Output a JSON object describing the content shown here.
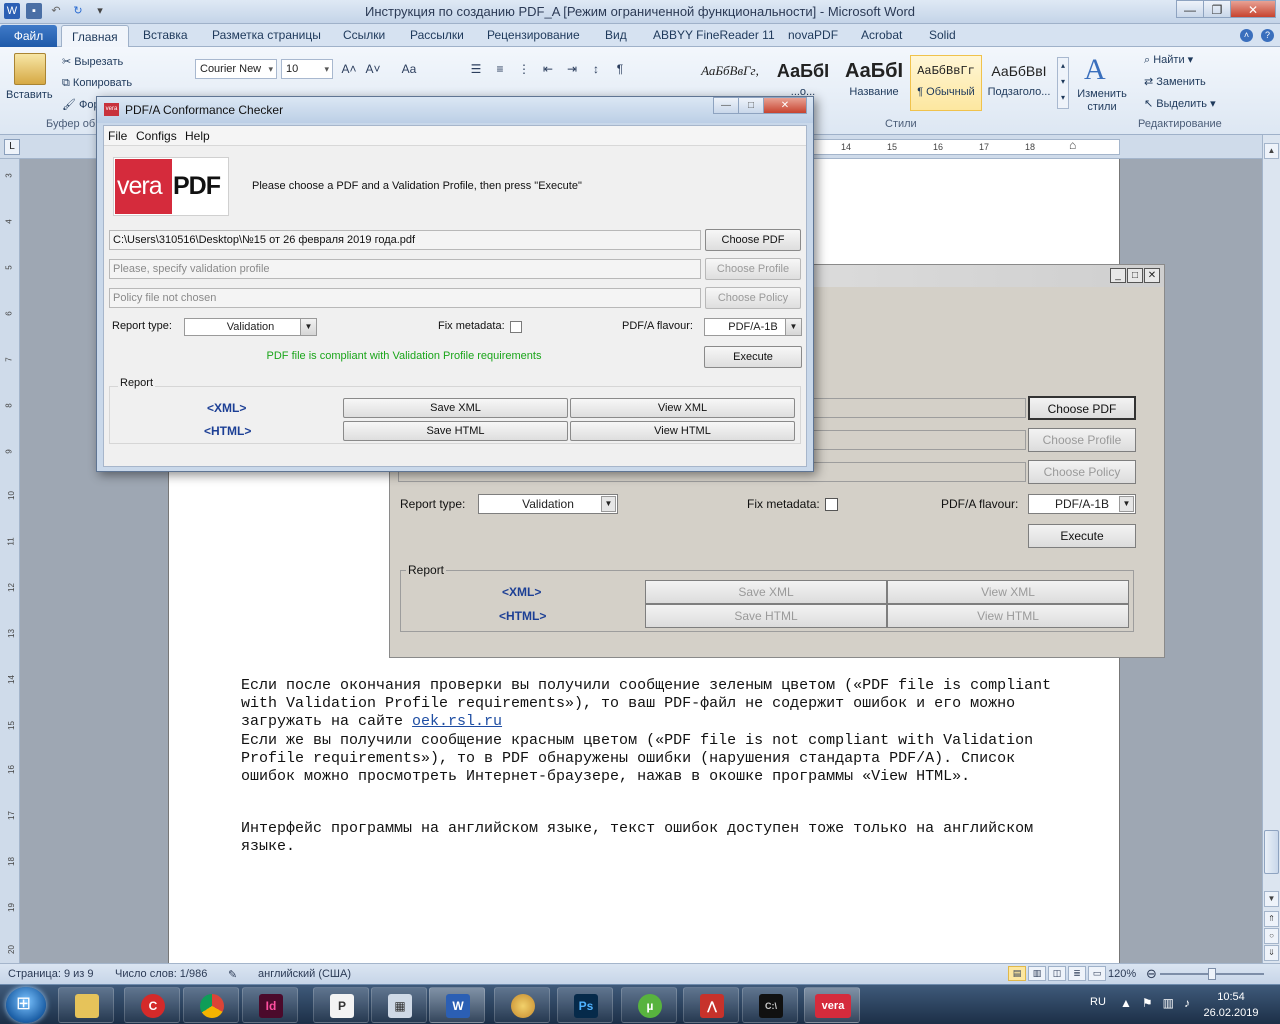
{
  "word": {
    "title": "Инструкция по созданию PDF_A [Режим ограниченной функциональности]  -  Microsoft Word",
    "tabs": [
      "Файл",
      "Главная",
      "Вставка",
      "Разметка страницы",
      "Ссылки",
      "Рассылки",
      "Рецензирование",
      "Вид",
      "ABBYY FineReader 11",
      "novaPDF",
      "Acrobat",
      "Solid"
    ],
    "active_tab": "Главная",
    "clipboard": {
      "paste": "Вставить",
      "cut": "Вырезать",
      "copy": "Копировать",
      "format": "Фор",
      "group_label": "Буфер об"
    },
    "font": {
      "family": "Courier New",
      "size": "10"
    },
    "styles": {
      "items": [
        {
          "sample": "АаБбВвГг,",
          "name": ""
        },
        {
          "sample": "АаБбІ",
          "name": "...о..."
        },
        {
          "sample": "АаБбІ",
          "name": "Название"
        },
        {
          "sample": "АаБбВвГг",
          "name": "¶ Обычный"
        },
        {
          "sample": "АаБбВвІ",
          "name": "Подзаголо..."
        }
      ],
      "change_styles": "Изменить стили",
      "group_label": "Стили"
    },
    "editing": {
      "find": "Найти",
      "replace": "Заменить",
      "select": "Выделить",
      "group_label": "Редактирование"
    },
    "ruler_numbers": [
      "14",
      "15",
      "16",
      "17",
      "18"
    ],
    "vruler_numbers": [
      "3",
      "4",
      "5",
      "6",
      "7",
      "8",
      "9",
      "10",
      "11",
      "12",
      "13",
      "14",
      "15",
      "16",
      "17",
      "18",
      "19",
      "20"
    ],
    "statusbar": {
      "page": "Страница: 9 из 9",
      "words": "Число слов: 1/986",
      "language": "английский (США)",
      "zoom": "120%"
    }
  },
  "embedded_screenshot": {
    "choose_pdf": "Choose PDF",
    "choose_profile": "Choose Profile",
    "choose_policy": "Choose Policy",
    "report_type_label": "Report type:",
    "report_type_value": "Validation",
    "fix_metadata_label": "Fix metadata:",
    "flavour_label": "PDF/A flavour:",
    "flavour_value": "PDF/A-1B",
    "execute": "Execute",
    "report_label": "Report",
    "xml_label": "<XML>",
    "html_label": "<HTML>",
    "save_xml": "Save XML",
    "view_xml": "View XML",
    "save_html": "Save HTML",
    "view_html": "View HTML"
  },
  "document": {
    "p1_before_link": "Если после окончания проверки вы получили сообщение зеленым цветом («PDF file is compliant with Validation Profile requirements»), то ваш PDF-файл не содержит ошибок и его можно загружать на сайте ",
    "p1_link": "oek.rsl.ru",
    "p2": "Если же вы получили сообщение красным цветом («PDF file is not compliant with Validation Profile requirements»), то в PDF обнаружены ошибки (нарушения стандарта PDF/A). Список ошибок можно просмотреть Интернет-браузере, нажав в окошке программы «View HTML».",
    "p3": "Интерфейс программы на английском языке, текст ошибок доступен тоже только на английском языке."
  },
  "vera_dialog": {
    "title": "PDF/A Conformance Checker",
    "menu": [
      "File",
      "Configs",
      "Help"
    ],
    "logo_left": "vera",
    "logo_right": "PDF",
    "prompt": "Please choose a PDF and a Validation Profile, then press \"Execute\"",
    "pdf_path": "C:\\Users\\310516\\Desktop\\№15 от 26 февраля 2019 года.pdf",
    "choose_pdf": "Choose PDF",
    "profile_placeholder": "Please, specify validation profile",
    "choose_profile": "Choose Profile",
    "policy_placeholder": "Policy file not chosen",
    "choose_policy": "Choose Policy",
    "report_type_label": "Report type:",
    "report_type_value": "Validation",
    "fix_metadata_label": "Fix metadata:",
    "flavour_label": "PDF/A flavour:",
    "flavour_value": "PDF/A-1B",
    "status": "PDF file is compliant with Validation Profile requirements",
    "status_color": "#1aa51a",
    "execute": "Execute",
    "report_label": "Report",
    "xml_label": "<XML>",
    "html_label": "<HTML>",
    "save_xml": "Save XML",
    "view_xml": "View XML",
    "save_html": "Save HTML",
    "view_html": "View HTML"
  },
  "taskbar": {
    "apps": [
      "explorer",
      "app-red",
      "chrome",
      "indesign",
      "publisher",
      "calculator",
      "word",
      "paint",
      "photoshop",
      "utorrent",
      "acrobat",
      "cmd",
      "vera"
    ],
    "indesign_label": "Id",
    "photoshop_label": "Ps",
    "word_label": "W",
    "vera_label": "vera",
    "language": "RU",
    "time": "10:54",
    "date": "26.02.2019"
  }
}
